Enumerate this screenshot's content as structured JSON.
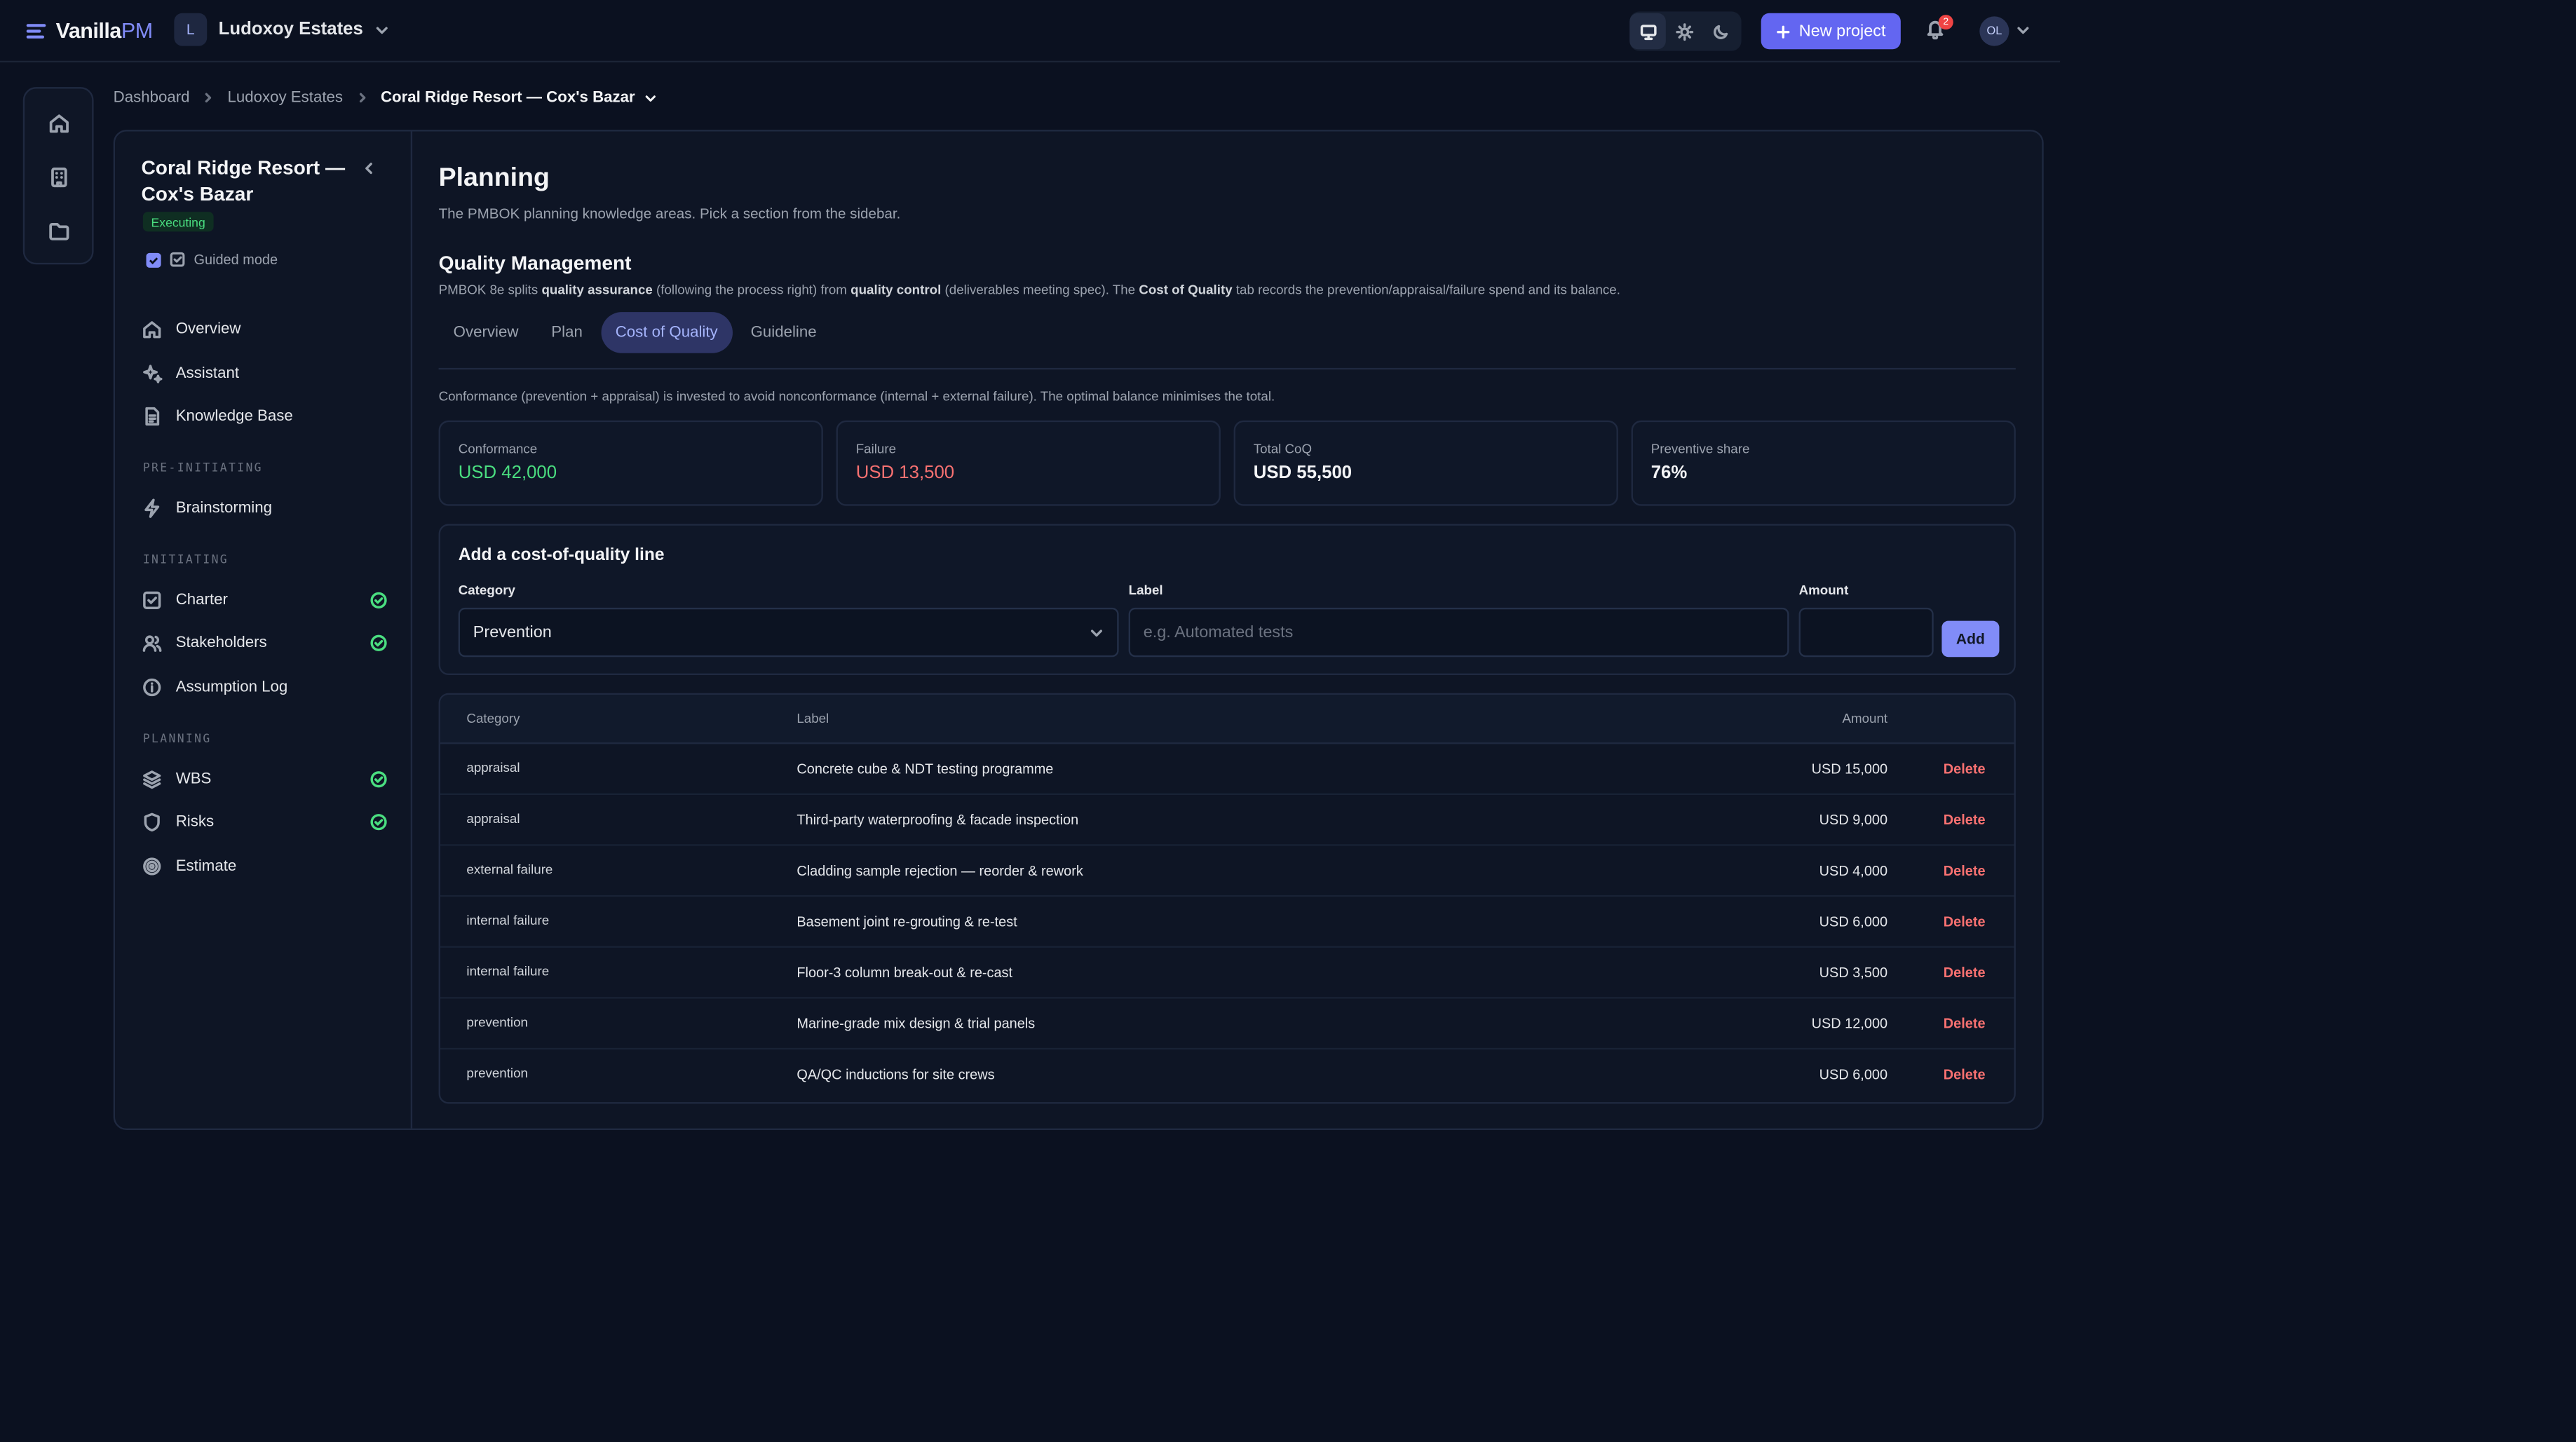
{
  "app": {
    "name_main": "Vanilla",
    "name_accent": "PM"
  },
  "org": {
    "initial": "L",
    "name": "Ludoxoy Estates"
  },
  "topbar": {
    "new_project_label": "New project",
    "notifications_count": "2",
    "user_initials": "OL",
    "theme_active": "system"
  },
  "breadcrumb": [
    "Dashboard",
    "Ludoxoy Estates",
    "Coral Ridge Resort — Cox's Bazar"
  ],
  "project": {
    "title": "Coral Ridge Resort — Cox's Bazar",
    "status": "Executing",
    "guided_mode_label": "Guided mode",
    "guided_mode": true
  },
  "sidebar": {
    "top_items": [
      {
        "label": "Overview",
        "icon": "home-icon"
      },
      {
        "label": "Assistant",
        "icon": "sparkles-icon"
      },
      {
        "label": "Knowledge Base",
        "icon": "document-icon"
      }
    ],
    "sections": [
      {
        "title": "PRE-INITIATING",
        "items": [
          {
            "label": "Brainstorming",
            "icon": "bolt-icon",
            "done": false
          }
        ]
      },
      {
        "title": "INITIATING",
        "items": [
          {
            "label": "Charter",
            "icon": "checkbox-icon",
            "done": true
          },
          {
            "label": "Stakeholders",
            "icon": "users-icon",
            "done": true
          },
          {
            "label": "Assumption Log",
            "icon": "info-icon",
            "done": false
          }
        ]
      },
      {
        "title": "PLANNING",
        "items": [
          {
            "label": "WBS",
            "icon": "layers-icon",
            "done": true
          },
          {
            "label": "Risks",
            "icon": "shield-icon",
            "done": true
          },
          {
            "label": "Estimate",
            "icon": "target-icon",
            "done": false
          }
        ]
      }
    ]
  },
  "page": {
    "title": "Planning",
    "subtitle": "The PMBOK planning knowledge areas. Pick a section from the sidebar.",
    "section_title": "Quality Management",
    "desc": {
      "t1": "PMBOK 8e splits ",
      "b1": "quality assurance",
      "t2": " (following the process right) from ",
      "b2": "quality control",
      "t3": " (deliverables meeting spec). The ",
      "b3": "Cost of Quality",
      "t4": " tab records the prevention/appraisal/failure spend and its balance."
    },
    "tabs": [
      "Overview",
      "Plan",
      "Cost of Quality",
      "Guideline"
    ],
    "active_tab": "Cost of Quality",
    "note": "Conformance (prevention + appraisal) is invested to avoid nonconformance (internal + external failure). The optimal balance minimises the total."
  },
  "stats": [
    {
      "label": "Conformance",
      "value": "USD 42,000",
      "tone": "green"
    },
    {
      "label": "Failure",
      "value": "USD 13,500",
      "tone": "red"
    },
    {
      "label": "Total CoQ",
      "value": "USD 55,500",
      "tone": "white"
    },
    {
      "label": "Preventive share",
      "value": "76%",
      "tone": "white"
    }
  ],
  "add_form": {
    "title": "Add a cost-of-quality line",
    "category_label": "Category",
    "category_value": "Prevention",
    "label_label": "Label",
    "label_placeholder": "e.g. Automated tests",
    "amount_label": "Amount",
    "amount_value": "",
    "add_button": "Add"
  },
  "table": {
    "headers": [
      "Category",
      "Label",
      "Amount"
    ],
    "delete_label": "Delete",
    "rows": [
      {
        "category": "appraisal",
        "label": "Concrete cube & NDT testing programme",
        "amount": "USD 15,000"
      },
      {
        "category": "appraisal",
        "label": "Third-party waterproofing & facade inspection",
        "amount": "USD 9,000"
      },
      {
        "category": "external failure",
        "label": "Cladding sample rejection — reorder & rework",
        "amount": "USD 4,000"
      },
      {
        "category": "internal failure",
        "label": "Basement joint re-grouting & re-test",
        "amount": "USD 6,000"
      },
      {
        "category": "internal failure",
        "label": "Floor-3 column break-out & re-cast",
        "amount": "USD 3,500"
      },
      {
        "category": "prevention",
        "label": "Marine-grade mix design & trial panels",
        "amount": "USD 12,000"
      },
      {
        "category": "prevention",
        "label": "QA/QC inductions for site crews",
        "amount": "USD 6,000"
      }
    ]
  },
  "colors": {
    "accent": "#818cf8",
    "primary_button": "#6366f1",
    "success": "#4ade80",
    "danger": "#f87171",
    "background": "#0b1120"
  }
}
